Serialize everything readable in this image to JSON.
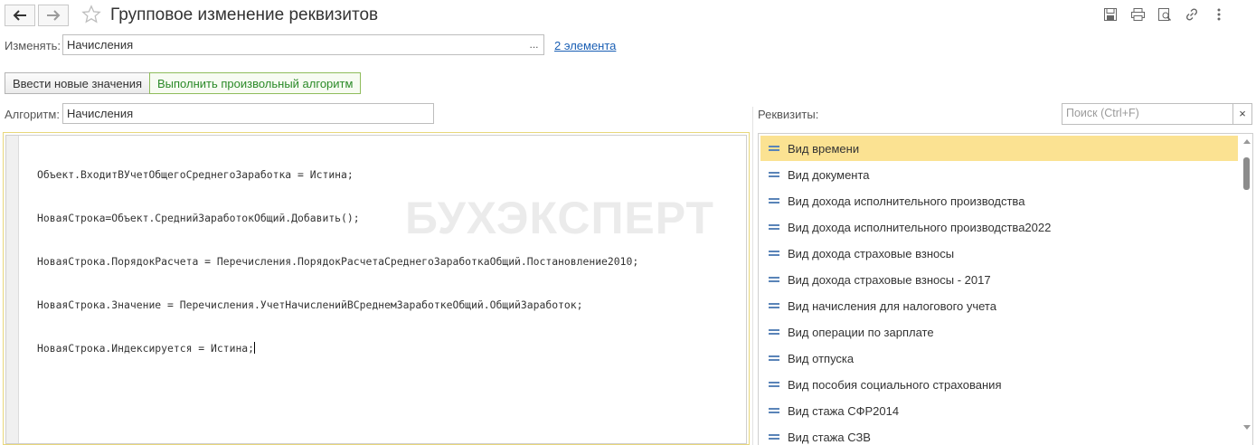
{
  "header": {
    "title": "Групповое изменение реквизитов",
    "back_icon": "arrow-left-icon",
    "forward_icon": "arrow-right-icon",
    "favorite_icon": "star-icon",
    "tools": [
      "save-icon",
      "print-icon",
      "preview-icon",
      "link-icon",
      "more-icon"
    ]
  },
  "change_row": {
    "label": "Изменять:",
    "value": "Начисления",
    "select_button": "...",
    "elements_link": "2 элемента"
  },
  "mode_buttons": {
    "enter_values": "Ввести новые значения",
    "run_algorithm": "Выполнить произвольный алгоритм"
  },
  "algorithm": {
    "label": "Алгоритм:",
    "value": "Начисления",
    "code_lines": [
      "Объект.ВходитВУчетОбщегоСреднегоЗаработка = Истина;",
      "НоваяСтрока=Объект.СреднийЗаработокОбщий.Добавить();",
      "НоваяСтрока.ПорядокРасчета = Перечисления.ПорядокРасчетаСреднегоЗаработкаОбщий.Постановление2010;",
      "НоваяСтрока.Значение = Перечисления.УчетНачисленийВСреднемЗаработкеОбщий.ОбщийЗаработок;",
      "НоваяСтрока.Индексируется = Истина;"
    ],
    "watermark": "БУХЭКСПЕРТ"
  },
  "attributes": {
    "label": "Реквизиты:",
    "search_placeholder": "Поиск (Ctrl+F)",
    "clear_label": "×",
    "selected_index": 0,
    "accent_color": "#fbe292",
    "items": [
      "Вид времени",
      "Вид документа",
      "Вид дохода исполнительного производства",
      "Вид дохода исполнительного производства2022",
      "Вид дохода страховые взносы",
      "Вид дохода страховые взносы - 2017",
      "Вид начисления для налогового учета",
      "Вид операции по зарплате",
      "Вид отпуска",
      "Вид пособия социального страхования",
      "Вид стажа  СФР2014",
      "Вид стажа СЗВ"
    ]
  }
}
